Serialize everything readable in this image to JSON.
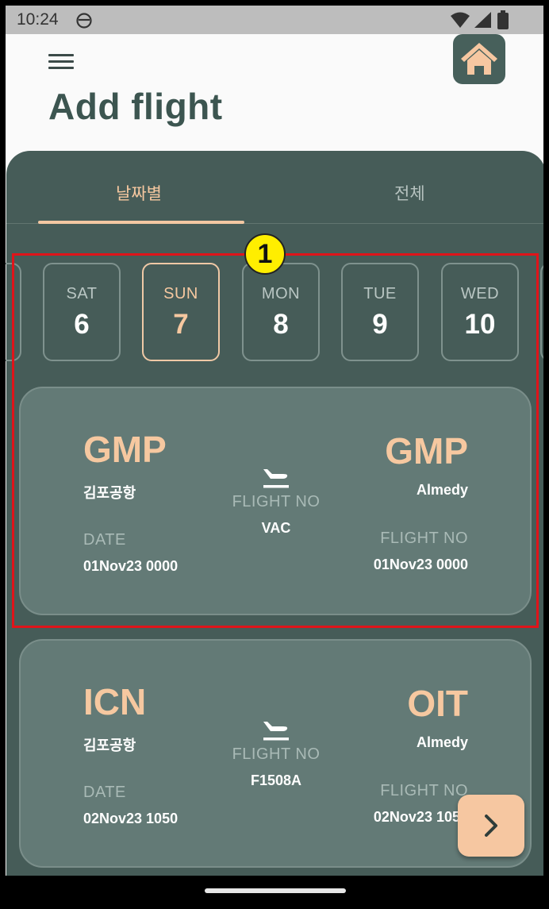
{
  "status_bar": {
    "time": "10:24",
    "icons": [
      "sync-icon",
      "wifi-icon",
      "cell-signal-icon",
      "battery-icon"
    ]
  },
  "header": {
    "menu_icon": "hamburger-menu-icon",
    "home_icon": "home-icon",
    "title": "Add flight"
  },
  "tabs": [
    {
      "label": "날짜별",
      "active": true
    },
    {
      "label": "전체",
      "active": false
    }
  ],
  "annotation": {
    "marker": "1"
  },
  "date_strip": {
    "days": [
      {
        "dow": "SAT",
        "day": "6",
        "selected": false
      },
      {
        "dow": "SUN",
        "day": "7",
        "selected": true
      },
      {
        "dow": "MON",
        "day": "8",
        "selected": false
      },
      {
        "dow": "TUE",
        "day": "9",
        "selected": false
      },
      {
        "dow": "WED",
        "day": "10",
        "selected": false
      }
    ]
  },
  "flights": [
    {
      "from_code": "GMP",
      "from_name": "김포공항",
      "to_code": "GMP",
      "to_name": "Almedy",
      "date_label": "DATE",
      "date_value": "01Nov23 0000",
      "mid_label": "FLIGHT NO",
      "mid_value": "VAC",
      "right_label": "FLIGHT NO",
      "right_value": "01Nov23 0000"
    },
    {
      "from_code": "ICN",
      "from_name": "김포공항",
      "to_code": "OIT",
      "to_name": "Almedy",
      "date_label": "DATE",
      "date_value": "02Nov23 1050",
      "mid_label": "FLIGHT NO",
      "mid_value": "F1508A",
      "right_label": "FLIGHT NO",
      "right_value": "02Nov23 1050"
    }
  ],
  "next_button_icon": "chevron-right-icon",
  "colors": {
    "panel": "#465c58",
    "card": "#637a76",
    "accent": "#f6c8a0",
    "highlight": "#e0141a"
  }
}
